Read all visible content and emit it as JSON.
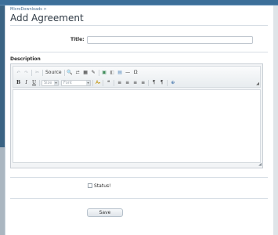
{
  "breadcrumb": "MicroDownloads >",
  "page_title": "Add Agreement",
  "form": {
    "title_label": "Title:",
    "title_value": "",
    "description_label": "Description",
    "status_label": "Status!",
    "status_checked": false,
    "save_label": "Save"
  },
  "editor": {
    "toolbar_row1": [
      {
        "name": "undo-icon",
        "glyph": "↶",
        "disabled": true
      },
      {
        "name": "redo-icon",
        "glyph": "↷",
        "disabled": true
      },
      {
        "name": "cut-icon",
        "glyph": "✂",
        "disabled": true
      },
      {
        "name": "source-button",
        "glyph": "Source",
        "wide": true
      },
      {
        "name": "find-icon",
        "glyph": "🔍"
      },
      {
        "name": "replace-icon",
        "glyph": "⇄"
      },
      {
        "name": "select-all-icon",
        "glyph": "▦"
      },
      {
        "name": "remove-format-icon",
        "glyph": "✎"
      },
      {
        "name": "image-icon",
        "glyph": "▣",
        "color": "#3d8a58"
      },
      {
        "name": "flash-icon",
        "glyph": "◧",
        "color": "#9c9c9c"
      },
      {
        "name": "table-icon",
        "glyph": "▤",
        "color": "#5a8dbf"
      },
      {
        "name": "horizontal-rule-icon",
        "glyph": "—"
      },
      {
        "name": "special-char-icon",
        "glyph": "Ω"
      }
    ],
    "toolbar_row2": {
      "bold": "B",
      "italic": "I",
      "underline": "U",
      "size_placeholder": "Size",
      "font_placeholder": "Font",
      "text_color_glyph": "A",
      "blockquote_glyph": "❝",
      "align_glyphs": [
        "≡",
        "≡",
        "≡",
        "≡"
      ],
      "direction_glyphs": [
        "¶",
        "¶"
      ],
      "link_glyph": "⊕"
    },
    "content": ""
  },
  "colors": {
    "background": "#2f5878",
    "panel": "#ffffff",
    "accent": "#4a6f93"
  }
}
